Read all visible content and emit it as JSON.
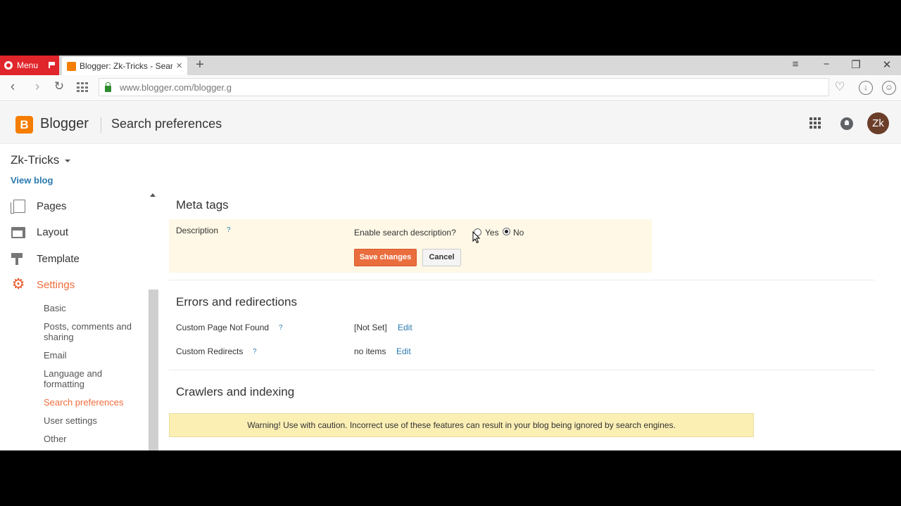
{
  "browser": {
    "menu_label": "Menu",
    "tab_title": "Blogger: Zk-Tricks - Search",
    "url": "www.blogger.com/blogger.g"
  },
  "header": {
    "logo_letter": "B",
    "brand": "Blogger",
    "page_title": "Search preferences",
    "avatar_initials": "Zk"
  },
  "sidebar": {
    "blog_name": "Zk-Tricks",
    "view_blog": "View blog",
    "items": [
      {
        "label": "Pages",
        "icon": "pages-icon"
      },
      {
        "label": "Layout",
        "icon": "layout-icon"
      },
      {
        "label": "Template",
        "icon": "template-icon"
      },
      {
        "label": "Settings",
        "icon": "gear-icon"
      }
    ],
    "settings_sub": [
      "Basic",
      "Posts, comments and sharing",
      "Email",
      "Language and formatting",
      "Search preferences",
      "User settings",
      "Other"
    ],
    "active_sub": "Search preferences"
  },
  "meta_tags": {
    "title": "Meta tags",
    "description_label": "Description",
    "help": "?",
    "enable_label": "Enable search description?",
    "yes_label": "Yes",
    "no_label": "No",
    "selected": "No",
    "save_label": "Save changes",
    "cancel_label": "Cancel"
  },
  "errors": {
    "title": "Errors and redirections",
    "not_found_label": "Custom Page Not Found",
    "not_found_value": "[Not Set]",
    "redirects_label": "Custom Redirects",
    "redirects_value": "no items",
    "edit_label": "Edit"
  },
  "crawlers": {
    "title": "Crawlers and indexing",
    "warning": "Warning! Use with caution. Incorrect use of these features can result in your blog being ignored by search engines."
  },
  "colors": {
    "accent": "#f06b3b",
    "link": "#2a7ab0",
    "highlight_bg": "#fff8e6",
    "warning_bg": "#fbefb4"
  }
}
